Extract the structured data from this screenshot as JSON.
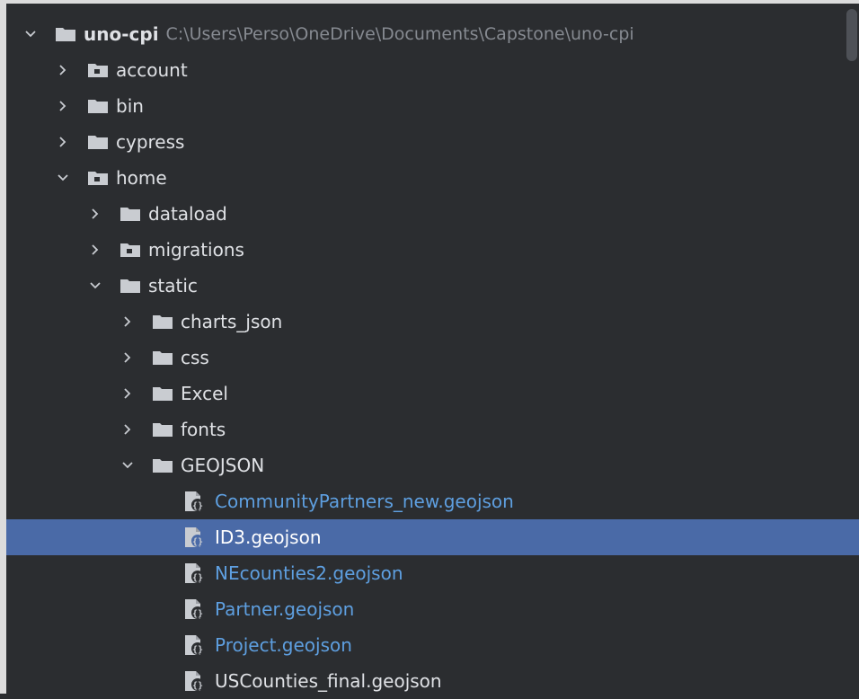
{
  "project": {
    "name": "uno-cpi",
    "path": "C:\\Users\\Perso\\OneDrive\\Documents\\Capstone\\uno-cpi"
  },
  "colors": {
    "background": "#2b2d30",
    "selection": "#4a6aa7",
    "folder": "#c9ccd1",
    "file_link": "#5e9fe0",
    "path_gray": "#868a91"
  },
  "tree": {
    "account": "account",
    "bin": "bin",
    "cypress": "cypress",
    "home": "home",
    "dataload": "dataload",
    "migrations": "migrations",
    "static": "static",
    "charts_json": "charts_json",
    "css": "css",
    "excel": "Excel",
    "fonts": "fonts",
    "geojson": "GEOJSON",
    "files": [
      "CommunityPartners_new.geojson",
      "ID3.geojson",
      "NEcounties2.geojson",
      "Partner.geojson",
      "Project.geojson",
      "USCounties_final.geojson"
    ]
  },
  "icons": {
    "expanded": "chevron-down-icon",
    "collapsed": "chevron-right-icon",
    "folder": "folder-icon",
    "package": "package-folder-icon",
    "file": "geojson-file-icon"
  }
}
